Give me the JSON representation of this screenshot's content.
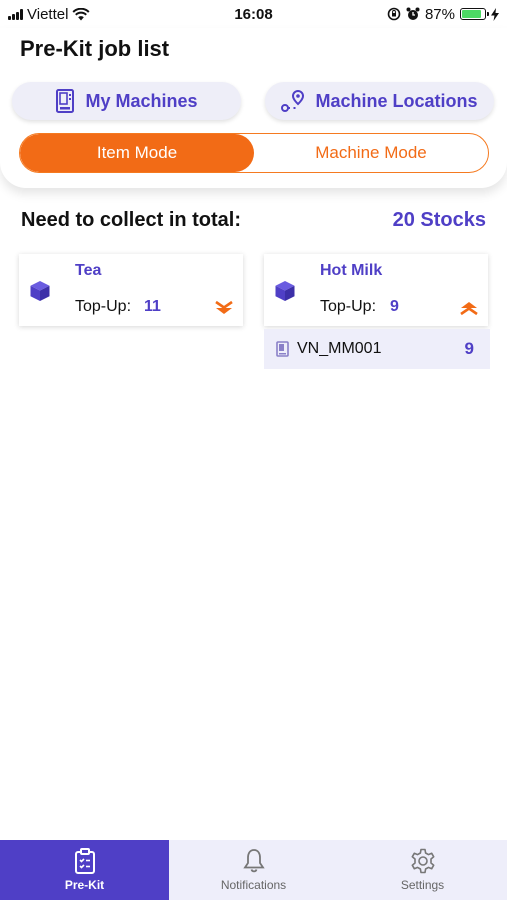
{
  "status_bar": {
    "carrier": "Viettel",
    "time": "16:08",
    "battery": "87%",
    "battery_level": 0.87
  },
  "header": {
    "title": "Pre-Kit job list",
    "my_machines_label": "My Machines",
    "machine_locations_label": "Machine Locations"
  },
  "mode_toggle": {
    "item_mode_label": "Item Mode",
    "machine_mode_label": "Machine Mode",
    "selected": "Item Mode"
  },
  "summary": {
    "label": "Need to collect in total:",
    "value": "20 Stocks"
  },
  "items": [
    {
      "name": "Tea",
      "topup_label": "Top-Up:",
      "topup_value": "11",
      "expanded": false
    },
    {
      "name": "Hot Milk",
      "topup_label": "Top-Up:",
      "topup_value": "9",
      "expanded": true,
      "machines": [
        {
          "name": "VN_MM001",
          "qty": "9"
        }
      ]
    }
  ],
  "bottom_nav": {
    "items": [
      {
        "label": "Pre-Kit",
        "icon": "clipboard-icon",
        "active": true
      },
      {
        "label": "Notifications",
        "icon": "bell-icon",
        "active": false
      },
      {
        "label": "Settings",
        "icon": "gear-icon",
        "active": false
      }
    ]
  },
  "colors": {
    "brand_purple": "#4f3fc6",
    "accent_orange": "#f26b16",
    "light_lavender": "#eeeefa"
  }
}
